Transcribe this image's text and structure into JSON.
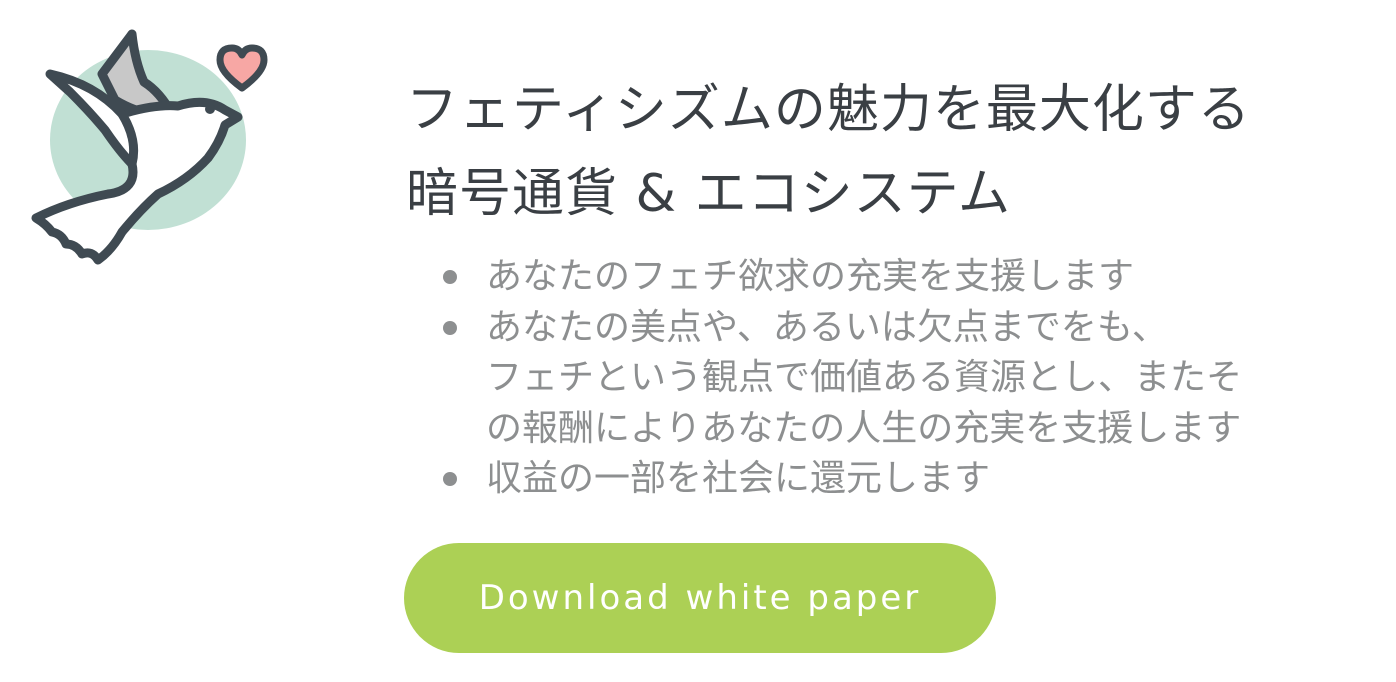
{
  "headline": {
    "line1": "フェティシズムの魅力を最大化する",
    "line2": "暗号通貨 & エコシステム"
  },
  "features": [
    {
      "lines": [
        "あなたのフェチ欲求の充実を支援します"
      ]
    },
    {
      "lines": [
        "あなたの美点や、あるいは欠点までをも、",
        "フェチという観点で価値ある資源とし、またそ",
        "の報酬によりあなたの人生の充実を支援します"
      ]
    },
    {
      "lines": [
        "収益の一部を社会に還元します"
      ]
    }
  ],
  "cta": {
    "label": "Download white paper"
  },
  "colors": {
    "accent": "#acd055",
    "logo_circle": "#c1e0d4",
    "logo_wing": "#c8c8c8",
    "logo_heart": "#f7a7a4",
    "logo_stroke": "#3f4a52",
    "text_dark": "#3a3f44",
    "text_muted": "#8d8f90"
  },
  "icons": {
    "logo": "dove-with-heart-icon"
  }
}
